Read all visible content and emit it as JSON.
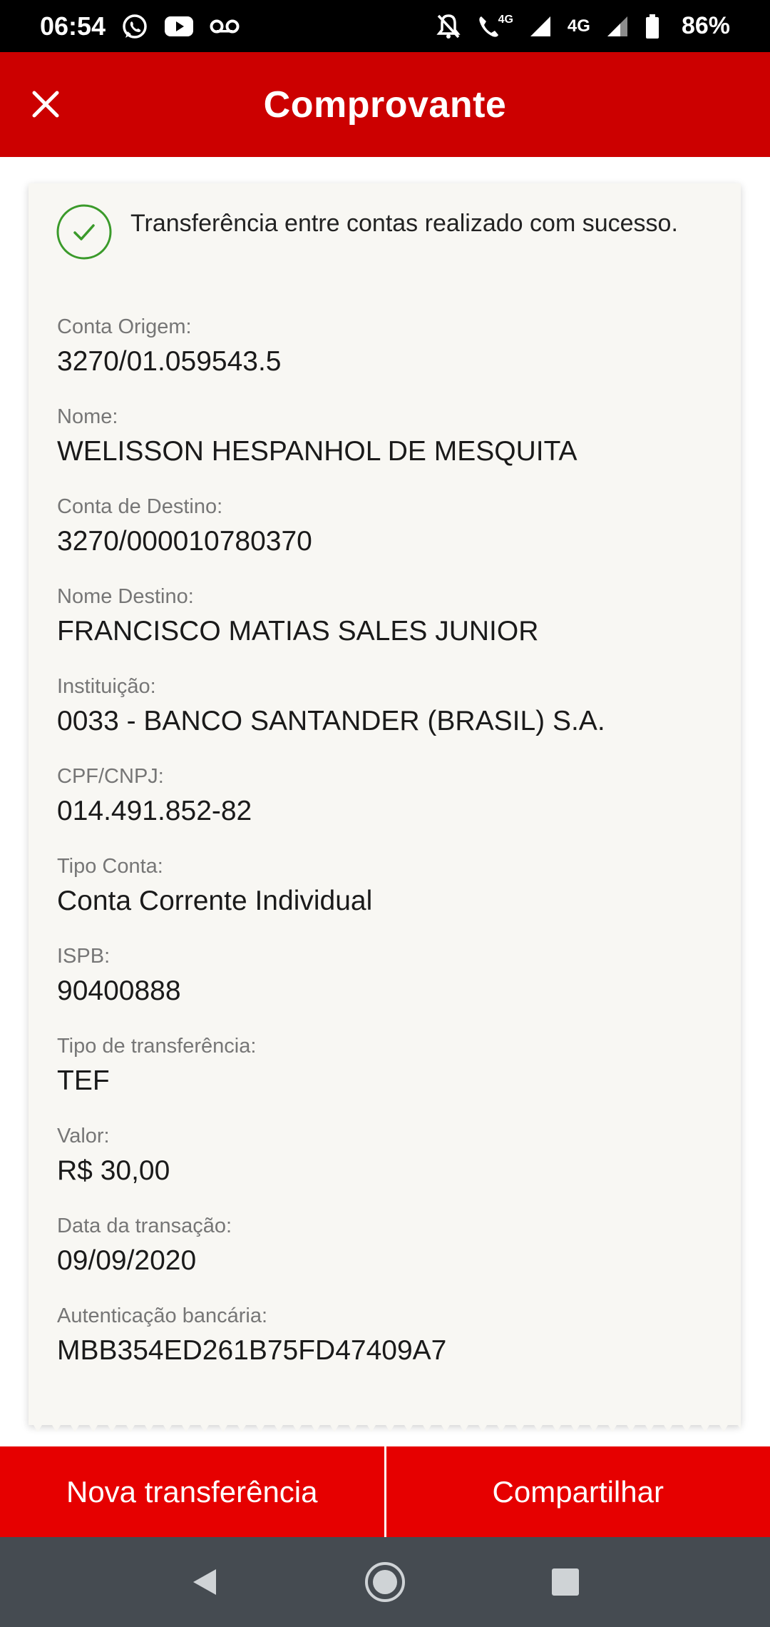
{
  "status_bar": {
    "time": "06:54",
    "network_1": "4G",
    "network_2": "4G",
    "battery": "86%",
    "icons": [
      "whatsapp-icon",
      "youtube-icon",
      "voicemail-icon",
      "muted-bell-icon",
      "wifi-call-icon",
      "signal-icon",
      "battery-icon"
    ]
  },
  "header": {
    "title": "Comprovante",
    "close_icon": "close-icon",
    "color": "#cc0000"
  },
  "receipt": {
    "success_message": "Transferência entre contas realizado com sucesso.",
    "success_icon": "check-circle-icon",
    "success_color": "#3a9a2a",
    "fields": [
      {
        "label": "Conta Origem:",
        "value": "3270/01.059543.5"
      },
      {
        "label": "Nome:",
        "value": "WELISSON HESPANHOL DE MESQUITA"
      },
      {
        "label": "Conta de Destino:",
        "value": "3270/000010780370"
      },
      {
        "label": "Nome Destino:",
        "value": "FRANCISCO MATIAS SALES JUNIOR"
      },
      {
        "label": "Instituição:",
        "value": "0033 - BANCO SANTANDER (BRASIL) S.A."
      },
      {
        "label": "CPF/CNPJ:",
        "value": "014.491.852-82"
      },
      {
        "label": "Tipo Conta:",
        "value": "Conta Corrente Individual"
      },
      {
        "label": "ISPB:",
        "value": "90400888"
      },
      {
        "label": "Tipo de transferência:",
        "value": "TEF"
      },
      {
        "label": "Valor:",
        "value": "R$ 30,00"
      },
      {
        "label": "Data da transação:",
        "value": "09/09/2020"
      },
      {
        "label": "Autenticação bancária:",
        "value": "MBB354ED261B75FD47409A7"
      }
    ]
  },
  "actions": {
    "new_transfer": "Nova transferência",
    "share": "Compartilhar",
    "color": "#e60000"
  },
  "nav_bar": {
    "icons": [
      "back-icon",
      "home-icon",
      "recents-icon"
    ]
  }
}
